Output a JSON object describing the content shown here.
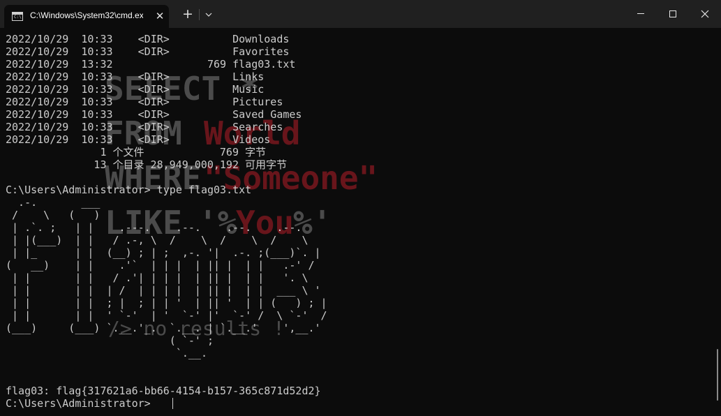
{
  "tab": {
    "title": "C:\\Windows\\System32\\cmd.ex",
    "icon_label": "C:\\"
  },
  "titlebar": {
    "new_tab_icon": "+",
    "close_tab_icon": "✕"
  },
  "terminal": {
    "lines": [
      "2022/10/29  10:33    <DIR>          Downloads",
      "2022/10/29  10:33    <DIR>          Favorites",
      "2022/10/29  13:32               769 flag03.txt",
      "2022/10/29  10:33    <DIR>          Links",
      "2022/10/29  10:33    <DIR>          Music",
      "2022/10/29  10:33    <DIR>          Pictures",
      "2022/10/29  10:33    <DIR>          Saved Games",
      "2022/10/29  10:33    <DIR>          Searches",
      "2022/10/29  10:33    <DIR>          Videos",
      "               1 个文件            769 字节",
      "              13 个目录 28,949,000,192 可用字节",
      "",
      "C:\\Users\\Administrator> type flag03.txt",
      "  .-.       ___",
      " /    \\   (   )",
      " | .`. ;   | |    .---.    .--.    .--.    .--.",
      " | |(___)  | |   / .-, \\  /    \\  /    \\  /    \\",
      " | |_      | |  (__) ; | ;  ,-. '|  .-. ;(___)`. |",
      "(   __)    | |    .'`  | | |  | || |  | |   .-' /",
      " | |       | |   / .'| | | |  | || |  | |   '. \\",
      " | |       | |  | /  | | | |  | || |  | |  ___ \\ '",
      " | |       | |  ; |  ; | | '  | || '  | | (   ) ; |",
      " | |       | |  ' `-'  | '  `-' |'  `-' /  \\ `-'  /",
      "(___)     (___) `.__.'_.  `.__. | `.__.'    ',__.'",
      "                          ( `-' ;",
      "                           `.__.",
      "",
      "",
      "flag03: flag{317621a6-bb66-4154-b157-365c871d52d2}",
      "C:\\Users\\Administrator> "
    ]
  },
  "watermark": {
    "select": "SELECT *",
    "from": "FROM",
    "world": "World",
    "where": "WHERE",
    "someone": "\"Someone\"",
    "like": "LIKE",
    "pct_open": "'%",
    "you": "You",
    "pct_close": "%'",
    "no_results": "/> no results !"
  },
  "colors": {
    "background": "#0c0c0c",
    "titlebar": "#202020",
    "text": "#cccccc",
    "watermark_gray": "#8a8a8a",
    "watermark_red": "#c41e2a"
  }
}
